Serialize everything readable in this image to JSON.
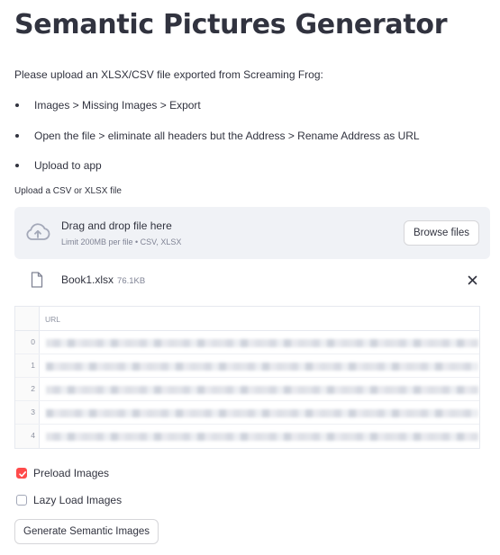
{
  "page": {
    "title": "Semantic Pictures Generator",
    "intro": "Please upload an XLSX/CSV file exported from Screaming Frog:",
    "bullets": [
      "Images > Missing Images > Export",
      "Open the file > eliminate all headers but the Address > Rename Address as URL",
      "Upload to app"
    ]
  },
  "uploader": {
    "label": "Upload a CSV or XLSX file",
    "drag_text": "Drag and drop file here",
    "limit_text": "Limit 200MB per file • CSV, XLSX",
    "browse_label": "Browse files",
    "icon": "cloud-upload-icon",
    "file": {
      "name": "Book1.xlsx",
      "size": "76.1KB",
      "icon": "file-icon",
      "remove_icon": "close-icon"
    }
  },
  "dataframe": {
    "column": "URL",
    "rows": [
      {
        "index": "0"
      },
      {
        "index": "1"
      },
      {
        "index": "2"
      },
      {
        "index": "3"
      },
      {
        "index": "4"
      }
    ]
  },
  "options": {
    "preload": {
      "label": "Preload Images",
      "checked": true
    },
    "lazy": {
      "label": "Lazy Load Images",
      "checked": false
    }
  },
  "actions": {
    "generate_label": "Generate Semantic Images"
  },
  "colors": {
    "accent": "#ff4b4b",
    "text": "#31333f",
    "dropzone_bg": "#f0f2f6",
    "muted": "#808495"
  }
}
